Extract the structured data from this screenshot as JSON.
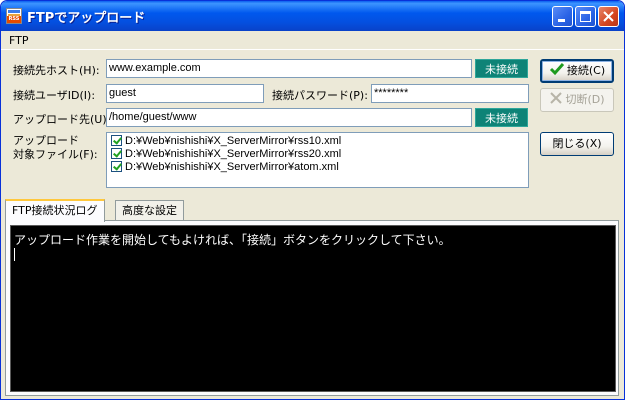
{
  "window": {
    "title": "FTPでアップロード"
  },
  "menu": {
    "items": [
      "FTP"
    ]
  },
  "form": {
    "host_label": "接続先ホスト(H):",
    "host_value": "www.example.com",
    "host_status": "未接続",
    "userid_label": "接続ユーザID(I):",
    "userid_value": "guest",
    "password_label": "接続パスワード(P):",
    "password_value": "********",
    "upload_label": "アップロード先(U):",
    "upload_value": "/home/guest/www",
    "upload_status": "未接続",
    "files_label_line1": "アップロード",
    "files_label_line2": "対象ファイル(F):",
    "files": [
      {
        "path": "D:¥Web¥nishishi¥X_ServerMirror¥rss10.xml",
        "checked": true
      },
      {
        "path": "D:¥Web¥nishishi¥X_ServerMirror¥rss20.xml",
        "checked": true
      },
      {
        "path": "D:¥Web¥nishishi¥X_ServerMirror¥atom.xml",
        "checked": true
      }
    ]
  },
  "buttons": {
    "connect": "接続(C)",
    "disconnect": "切断(D)",
    "close": "閉じる(X)"
  },
  "tabs": [
    "FTP接続状況ログ",
    "高度な設定"
  ],
  "log": {
    "lines": [
      "アップロード作業を開始してもよければ、「接続」ボタンをクリックして下さい。"
    ]
  },
  "colors": {
    "status_badge": "#0E8377",
    "titlebar": "#0058EE",
    "log_background": "#000000"
  },
  "icons": {
    "connect": "check-icon",
    "disconnect": "x-icon"
  }
}
